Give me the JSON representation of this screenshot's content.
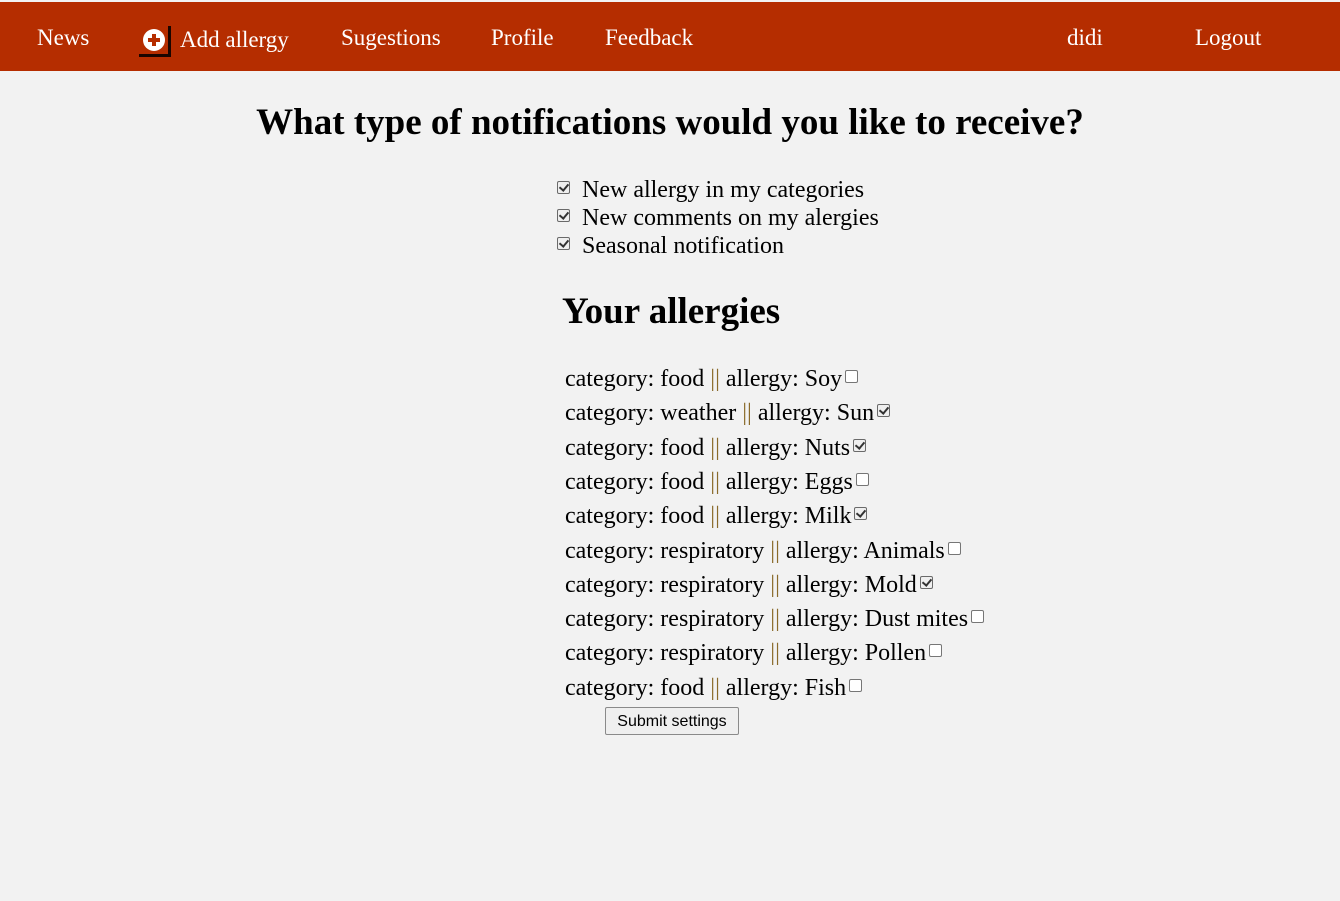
{
  "nav": {
    "news": "News",
    "add_allergy": "Add allergy",
    "suggestions": "Sugestions",
    "profile": "Profile",
    "feedback": "Feedback",
    "username": "didi",
    "logout": "Logout"
  },
  "colors": {
    "navbar_bg": "#b52d00",
    "page_bg": "#f2f2f2"
  },
  "notifications": {
    "heading": "What type of notifications would you like to receive?",
    "options": [
      {
        "label": "New allergy in my categories",
        "checked": true
      },
      {
        "label": "New comments on my alergies",
        "checked": true
      },
      {
        "label": "Seasonal notification",
        "checked": true
      }
    ]
  },
  "allergies": {
    "title": "Your allergies",
    "category_prefix": "category:",
    "separator": "||",
    "allergy_prefix": "allergy:",
    "items": [
      {
        "category": "food",
        "allergy": "Soy",
        "checked": false
      },
      {
        "category": "weather",
        "allergy": "Sun",
        "checked": true
      },
      {
        "category": "food",
        "allergy": "Nuts",
        "checked": true
      },
      {
        "category": "food",
        "allergy": "Eggs",
        "checked": false
      },
      {
        "category": "food",
        "allergy": "Milk",
        "checked": true
      },
      {
        "category": "respiratory",
        "allergy": "Animals",
        "checked": false
      },
      {
        "category": "respiratory",
        "allergy": "Mold",
        "checked": true
      },
      {
        "category": "respiratory",
        "allergy": "Dust mites",
        "checked": false
      },
      {
        "category": "respiratory",
        "allergy": "Pollen",
        "checked": false
      },
      {
        "category": "food",
        "allergy": "Fish",
        "checked": false
      }
    ]
  },
  "submit": {
    "label": "Submit settings"
  }
}
